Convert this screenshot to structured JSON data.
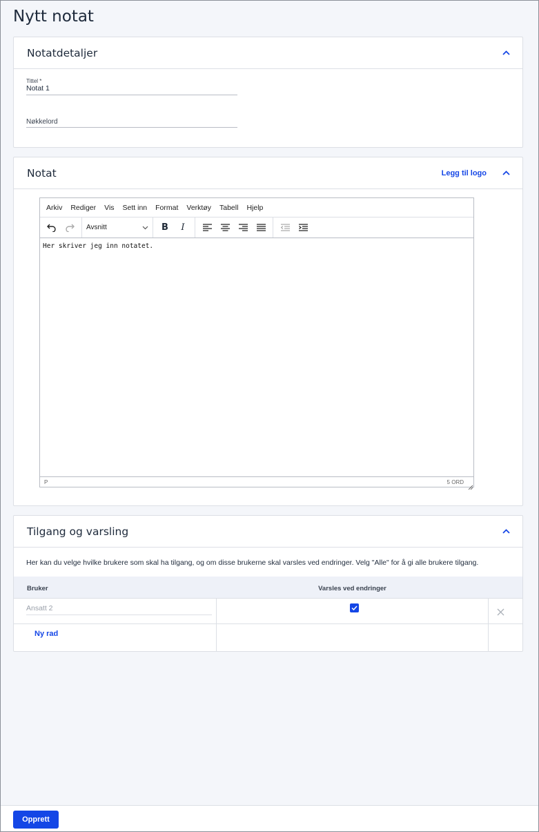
{
  "page": {
    "title": "Nytt notat"
  },
  "details": {
    "title": "Notatdetaljer",
    "title_field": {
      "label": "Tittel *",
      "value": "Notat 1"
    },
    "keyword_field": {
      "placeholder": "Nøkkelord"
    }
  },
  "note": {
    "title": "Notat",
    "add_logo": "Legg til logo",
    "menu": [
      "Arkiv",
      "Rediger",
      "Vis",
      "Sett inn",
      "Format",
      "Verktøy",
      "Tabell",
      "Hjelp"
    ],
    "format_select": "Avsnitt",
    "content": "Her skriver jeg inn notatet.",
    "status_path": "P",
    "word_count": "5 ORD"
  },
  "access": {
    "title": "Tilgang og varsling",
    "description": "Her kan du velge hvilke brukere som skal ha tilgang, og om disse brukerne skal varsles ved endringer. Velg \"Alle\" for å gi alle brukere tilgang.",
    "col_user": "Bruker",
    "col_notify": "Varsles ved endringer",
    "rows": [
      {
        "user_placeholder": "Ansatt 2",
        "notify": true
      }
    ],
    "new_row": "Ny rad"
  },
  "footer": {
    "create": "Opprett"
  },
  "colors": {
    "accent": "#1446e6",
    "background": "#f4f6fa"
  }
}
